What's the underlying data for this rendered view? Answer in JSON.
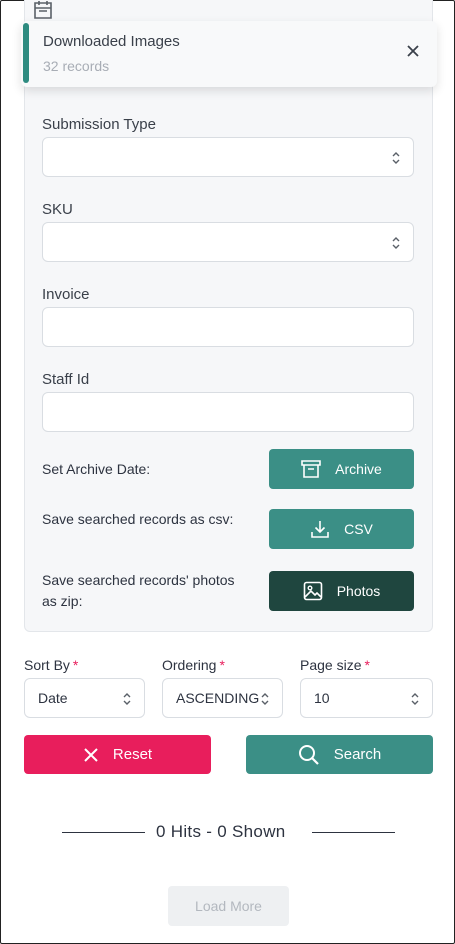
{
  "toast": {
    "title": "Downloaded Images",
    "subtitle": "32 records"
  },
  "filters": {
    "submission_type": {
      "label": "Submission Type",
      "value": ""
    },
    "sku": {
      "label": "SKU",
      "value": ""
    },
    "invoice": {
      "label": "Invoice",
      "value": ""
    },
    "staff_id": {
      "label": "Staff Id",
      "value": ""
    }
  },
  "actions": {
    "archive": {
      "label": "Set Archive Date:",
      "button": "Archive"
    },
    "csv": {
      "label": "Save searched records as csv:",
      "button": "CSV"
    },
    "photos": {
      "label": "Save searched records' photos as zip:",
      "button": "Photos"
    }
  },
  "sort": {
    "sort_by": {
      "label": "Sort By",
      "value": "Date"
    },
    "ordering": {
      "label": "Ordering",
      "value": "ASCENDING"
    },
    "page_size": {
      "label": "Page size",
      "value": "10"
    }
  },
  "buttons": {
    "reset": "Reset",
    "search": "Search",
    "load_more": "Load More"
  },
  "results": {
    "summary": "0 Hits - 0 Shown"
  },
  "colors": {
    "accent": "#3b8f86",
    "dark_accent": "#1f463f",
    "danger": "#e81e5c",
    "required": "#e81e5c"
  },
  "icons": {
    "top": "calendar-icon",
    "toast_close": "close-icon",
    "select_chevron": "chevron-up-down-icon",
    "archive": "archive-box-icon",
    "csv": "download-icon",
    "photos": "image-icon",
    "reset": "x-icon",
    "search": "search-icon"
  }
}
